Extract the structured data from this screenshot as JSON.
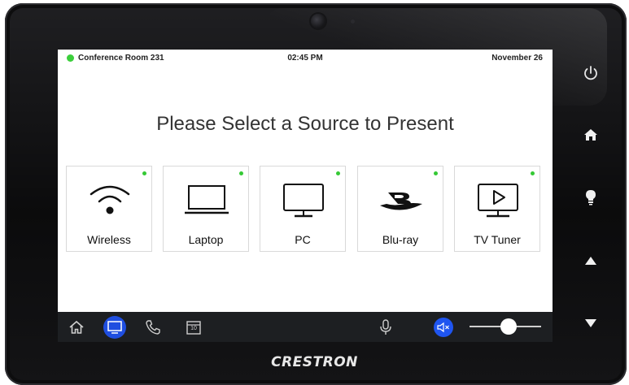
{
  "status": {
    "room": "Conference Room 231",
    "time": "02:45 PM",
    "date": "November 26",
    "room_indicator_color": "#3ccf3c"
  },
  "headline": "Please Select a Source to Present",
  "sources": [
    {
      "label": "Wireless",
      "icon": "wifi-icon",
      "status_color": "#35c935"
    },
    {
      "label": "Laptop",
      "icon": "laptop-icon",
      "status_color": "#35c935"
    },
    {
      "label": "PC",
      "icon": "monitor-icon",
      "status_color": "#35c935"
    },
    {
      "label": "Blu-ray",
      "icon": "bluray-icon",
      "status_color": "#35c935"
    },
    {
      "label": "TV Tuner",
      "icon": "tv-play-icon",
      "status_color": "#35c935"
    }
  ],
  "bottom_bar": {
    "items": [
      "home-icon",
      "display-icon",
      "phone-icon",
      "calendar-icon",
      "microphone-icon",
      "mute-icon"
    ],
    "active_item": "display-icon",
    "calendar_day": "10",
    "volume_level": 0.55,
    "accent_color": "#1f4ee0"
  },
  "hardware_buttons": [
    "power-icon",
    "home-icon",
    "light-bulb-icon",
    "up-arrow-icon",
    "down-arrow-icon"
  ],
  "brand": "CRESTRON"
}
